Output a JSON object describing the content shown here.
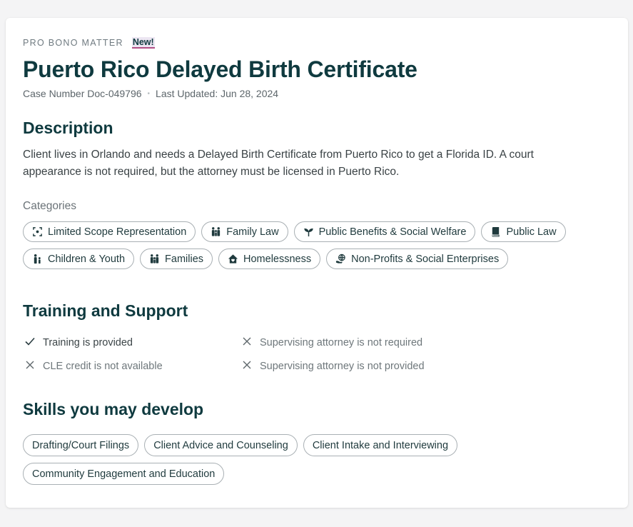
{
  "matter": {
    "eyebrow": "PRO BONO MATTER",
    "new_badge": "New!",
    "title": "Puerto Rico Delayed Birth Certificate",
    "case_number": "Case Number Doc-049796",
    "separator": "•",
    "last_updated": "Last Updated: Jun 28, 2024"
  },
  "description": {
    "heading": "Description",
    "text": "Client lives in Orlando and needs a Delayed Birth Certificate from Puerto Rico to get a Florida ID. A court appearance is not required, but the attorney must be licensed in Puerto Rico."
  },
  "categories": {
    "label": "Categories",
    "items": [
      {
        "label": "Limited Scope Representation",
        "icon": "scope-icon"
      },
      {
        "label": "Family Law",
        "icon": "family-icon"
      },
      {
        "label": "Public Benefits & Social Welfare",
        "icon": "sprout-icon"
      },
      {
        "label": "Public Law",
        "icon": "book-icon"
      },
      {
        "label": "Children & Youth",
        "icon": "parent-child-icon"
      },
      {
        "label": "Families",
        "icon": "family-icon"
      },
      {
        "label": "Homelessness",
        "icon": "house-heart-icon"
      },
      {
        "label": "Non-Profits & Social Enterprises",
        "icon": "globe-hand-icon"
      }
    ]
  },
  "training": {
    "heading": "Training and Support",
    "items": [
      {
        "label": "Training is provided",
        "icon": "check-icon",
        "status": "yes"
      },
      {
        "label": "Supervising attorney is not required",
        "icon": "x-icon",
        "status": "no"
      },
      {
        "label": "CLE credit is not available",
        "icon": "x-icon",
        "status": "no"
      },
      {
        "label": "Supervising attorney is not provided",
        "icon": "x-icon",
        "status": "no"
      }
    ]
  },
  "skills": {
    "heading": "Skills you may develop",
    "items": [
      "Drafting/Court Filings",
      "Client Advice and Counseling",
      "Client Intake and Interviewing",
      "Community Engagement and Education"
    ]
  },
  "colors": {
    "heading": "#0f3a3f",
    "badge_underline": "#b14f86",
    "chip_border": "#a9b0b4"
  }
}
